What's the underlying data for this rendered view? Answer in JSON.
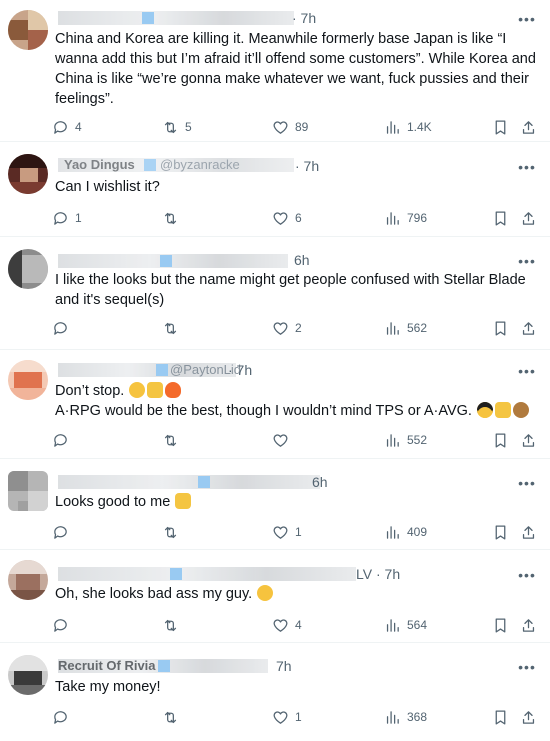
{
  "tweets": [
    {
      "time": "· 7h",
      "text_lines": [
        "China and Korea are killing it. Meanwhile formerly base Japan is like “I",
        "wanna add this but I’m afraid it’ll offend some customers”. While Korea and",
        "China is like “we’re gonna make whatever we want, fuck pussies and their",
        "feelings”."
      ],
      "replies": "4",
      "reposts": "5",
      "likes": "89",
      "views": "1.4K"
    },
    {
      "name_fragment": "Yao Dingus",
      "handle_fragment": "@byzanracke",
      "time": "· 7h",
      "text_lines": [
        "Can I wishlist it?"
      ],
      "replies": "1",
      "reposts": "",
      "likes": "6",
      "views": "796"
    },
    {
      "time": "6h",
      "text_lines": [
        "I like the looks but the name might get people confused with Stellar Blade",
        "and it's sequel(s)"
      ],
      "replies": "",
      "reposts": "",
      "likes": "2",
      "views": "562"
    },
    {
      "handle_fragment": "@PaytonLid",
      "time": "· 7h",
      "text_lines": [
        "Don’t stop.",
        "A·RPG would be the best, though I wouldn’t mind TPS or A·AVG."
      ],
      "replies": "",
      "reposts": "",
      "likes": "",
      "views": "552"
    },
    {
      "time": "6h",
      "text_lines": [
        "Looks good to me"
      ],
      "replies": "",
      "reposts": "",
      "likes": "1",
      "views": "409"
    },
    {
      "handle_fragment": "LV",
      "time": "· 7h",
      "text_lines": [
        "Oh, she looks bad ass my guy."
      ],
      "replies": "",
      "reposts": "",
      "likes": "4",
      "views": "564"
    },
    {
      "name_fragment": "Recruit Of Rivia",
      "time": "7h",
      "text_lines": [
        "Take my money!"
      ],
      "replies": "",
      "reposts": "",
      "likes": "1",
      "views": "368"
    }
  ],
  "icons": {
    "more": "more-options-icon",
    "reply": "reply-icon",
    "repost": "repost-icon",
    "like": "like-icon",
    "views": "views-icon",
    "bookmark": "bookmark-icon",
    "share": "share-icon"
  },
  "emoji": [
    "grinning-sweat-emoji",
    "thumbs-up-emoji",
    "fire-emoji",
    "sunglasses-emoji",
    "victory-hand-emoji",
    "cowboy-emoji",
    "thumbs-up-emoji",
    "astonished-emoji"
  ],
  "colors": {
    "text": "#0f1419",
    "muted": "#536471",
    "divider": "#eff3f4",
    "verified": "#1d9bf0"
  }
}
